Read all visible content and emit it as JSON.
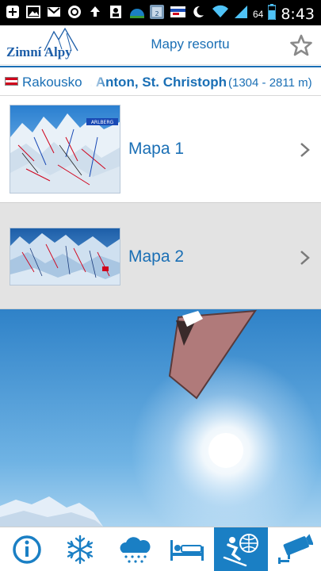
{
  "status_bar": {
    "time": "8:43",
    "battery_percent": "64",
    "icons": [
      "plus-icon",
      "image-icon",
      "gmail-icon",
      "sync-icon",
      "upload-icon",
      "photo-icon",
      "weather-icon",
      "calendar-icon",
      "card-icon",
      "moon-icon",
      "wifi-icon",
      "signal-icon",
      "battery-icon"
    ]
  },
  "header": {
    "logo_text": "Zimní Alpy",
    "title": "Mapy resortu",
    "favorite_icon": "star-outline-icon"
  },
  "resort_bar": {
    "flag": "austria-flag-icon",
    "country": "Rakousko",
    "resort_name": "St. Anton, St. Christoph",
    "altitude": "(1304 - 2811 m)"
  },
  "maps": [
    {
      "label": "Mapa 1",
      "thumb_badge": "ARLBERG",
      "chevron": "chevron-right-icon"
    },
    {
      "label": "Mapa 2",
      "thumb_badge": "",
      "chevron": "chevron-right-icon"
    }
  ],
  "bottom_nav": {
    "items": [
      {
        "icon": "info-icon",
        "active": false
      },
      {
        "icon": "snowflake-icon",
        "active": false
      },
      {
        "icon": "snow-cloud-icon",
        "active": false
      },
      {
        "icon": "bed-icon",
        "active": false
      },
      {
        "icon": "skier-globe-icon",
        "active": true
      },
      {
        "icon": "webcam-icon",
        "active": false
      }
    ]
  },
  "colors": {
    "accent": "#1a6fb5",
    "nav_active": "#1a7fc4",
    "selected_row": "#e3e3e3"
  }
}
